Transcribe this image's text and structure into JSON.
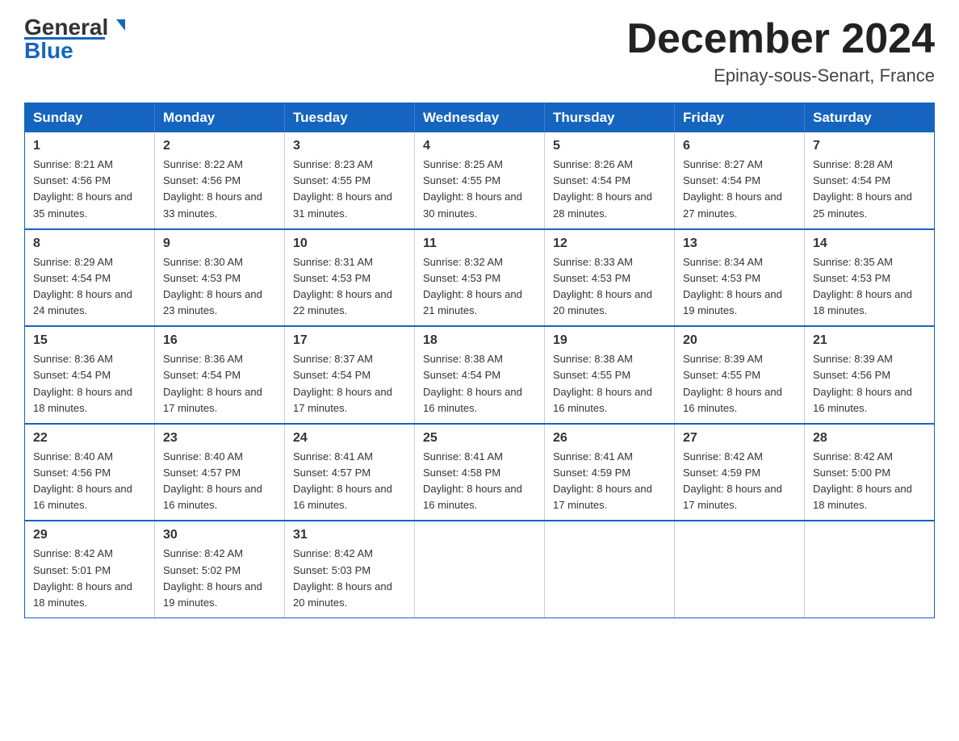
{
  "header": {
    "logo": {
      "text1": "General",
      "text2": "Blue"
    },
    "month_title": "December 2024",
    "location": "Epinay-sous-Senart, France"
  },
  "days_of_week": [
    "Sunday",
    "Monday",
    "Tuesday",
    "Wednesday",
    "Thursday",
    "Friday",
    "Saturday"
  ],
  "weeks": [
    [
      {
        "day": "1",
        "sunrise": "8:21 AM",
        "sunset": "4:56 PM",
        "daylight": "8 hours and 35 minutes."
      },
      {
        "day": "2",
        "sunrise": "8:22 AM",
        "sunset": "4:56 PM",
        "daylight": "8 hours and 33 minutes."
      },
      {
        "day": "3",
        "sunrise": "8:23 AM",
        "sunset": "4:55 PM",
        "daylight": "8 hours and 31 minutes."
      },
      {
        "day": "4",
        "sunrise": "8:25 AM",
        "sunset": "4:55 PM",
        "daylight": "8 hours and 30 minutes."
      },
      {
        "day": "5",
        "sunrise": "8:26 AM",
        "sunset": "4:54 PM",
        "daylight": "8 hours and 28 minutes."
      },
      {
        "day": "6",
        "sunrise": "8:27 AM",
        "sunset": "4:54 PM",
        "daylight": "8 hours and 27 minutes."
      },
      {
        "day": "7",
        "sunrise": "8:28 AM",
        "sunset": "4:54 PM",
        "daylight": "8 hours and 25 minutes."
      }
    ],
    [
      {
        "day": "8",
        "sunrise": "8:29 AM",
        "sunset": "4:54 PM",
        "daylight": "8 hours and 24 minutes."
      },
      {
        "day": "9",
        "sunrise": "8:30 AM",
        "sunset": "4:53 PM",
        "daylight": "8 hours and 23 minutes."
      },
      {
        "day": "10",
        "sunrise": "8:31 AM",
        "sunset": "4:53 PM",
        "daylight": "8 hours and 22 minutes."
      },
      {
        "day": "11",
        "sunrise": "8:32 AM",
        "sunset": "4:53 PM",
        "daylight": "8 hours and 21 minutes."
      },
      {
        "day": "12",
        "sunrise": "8:33 AM",
        "sunset": "4:53 PM",
        "daylight": "8 hours and 20 minutes."
      },
      {
        "day": "13",
        "sunrise": "8:34 AM",
        "sunset": "4:53 PM",
        "daylight": "8 hours and 19 minutes."
      },
      {
        "day": "14",
        "sunrise": "8:35 AM",
        "sunset": "4:53 PM",
        "daylight": "8 hours and 18 minutes."
      }
    ],
    [
      {
        "day": "15",
        "sunrise": "8:36 AM",
        "sunset": "4:54 PM",
        "daylight": "8 hours and 18 minutes."
      },
      {
        "day": "16",
        "sunrise": "8:36 AM",
        "sunset": "4:54 PM",
        "daylight": "8 hours and 17 minutes."
      },
      {
        "day": "17",
        "sunrise": "8:37 AM",
        "sunset": "4:54 PM",
        "daylight": "8 hours and 17 minutes."
      },
      {
        "day": "18",
        "sunrise": "8:38 AM",
        "sunset": "4:54 PM",
        "daylight": "8 hours and 16 minutes."
      },
      {
        "day": "19",
        "sunrise": "8:38 AM",
        "sunset": "4:55 PM",
        "daylight": "8 hours and 16 minutes."
      },
      {
        "day": "20",
        "sunrise": "8:39 AM",
        "sunset": "4:55 PM",
        "daylight": "8 hours and 16 minutes."
      },
      {
        "day": "21",
        "sunrise": "8:39 AM",
        "sunset": "4:56 PM",
        "daylight": "8 hours and 16 minutes."
      }
    ],
    [
      {
        "day": "22",
        "sunrise": "8:40 AM",
        "sunset": "4:56 PM",
        "daylight": "8 hours and 16 minutes."
      },
      {
        "day": "23",
        "sunrise": "8:40 AM",
        "sunset": "4:57 PM",
        "daylight": "8 hours and 16 minutes."
      },
      {
        "day": "24",
        "sunrise": "8:41 AM",
        "sunset": "4:57 PM",
        "daylight": "8 hours and 16 minutes."
      },
      {
        "day": "25",
        "sunrise": "8:41 AM",
        "sunset": "4:58 PM",
        "daylight": "8 hours and 16 minutes."
      },
      {
        "day": "26",
        "sunrise": "8:41 AM",
        "sunset": "4:59 PM",
        "daylight": "8 hours and 17 minutes."
      },
      {
        "day": "27",
        "sunrise": "8:42 AM",
        "sunset": "4:59 PM",
        "daylight": "8 hours and 17 minutes."
      },
      {
        "day": "28",
        "sunrise": "8:42 AM",
        "sunset": "5:00 PM",
        "daylight": "8 hours and 18 minutes."
      }
    ],
    [
      {
        "day": "29",
        "sunrise": "8:42 AM",
        "sunset": "5:01 PM",
        "daylight": "8 hours and 18 minutes."
      },
      {
        "day": "30",
        "sunrise": "8:42 AM",
        "sunset": "5:02 PM",
        "daylight": "8 hours and 19 minutes."
      },
      {
        "day": "31",
        "sunrise": "8:42 AM",
        "sunset": "5:03 PM",
        "daylight": "8 hours and 20 minutes."
      },
      null,
      null,
      null,
      null
    ]
  ]
}
